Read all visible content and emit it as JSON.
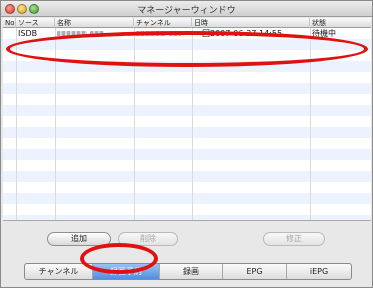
{
  "window": {
    "title": "マネージャーウィンドウ"
  },
  "table": {
    "columns": [
      "No",
      "ソース",
      "名称",
      "チャンネル",
      "日時",
      "状態"
    ],
    "rows": [
      {
        "no": "",
        "source": "ISDB",
        "name": "",
        "channel": "",
        "datetime": "一回2007-06-27 14:55",
        "status": "待機中"
      }
    ]
  },
  "buttons": {
    "add": "追加",
    "delete": "削除",
    "edit": "修正"
  },
  "tabs": [
    {
      "label": "チャンネル",
      "selected": false
    },
    {
      "label": "録画予約",
      "selected": true
    },
    {
      "label": "録画",
      "selected": false
    },
    {
      "label": "EPG",
      "selected": false
    },
    {
      "label": "iEPG",
      "selected": false
    }
  ],
  "colors": {
    "annotation": "#e01111",
    "selected_tab": "#4f8ee4",
    "row_stripe": "#edf3fe"
  }
}
